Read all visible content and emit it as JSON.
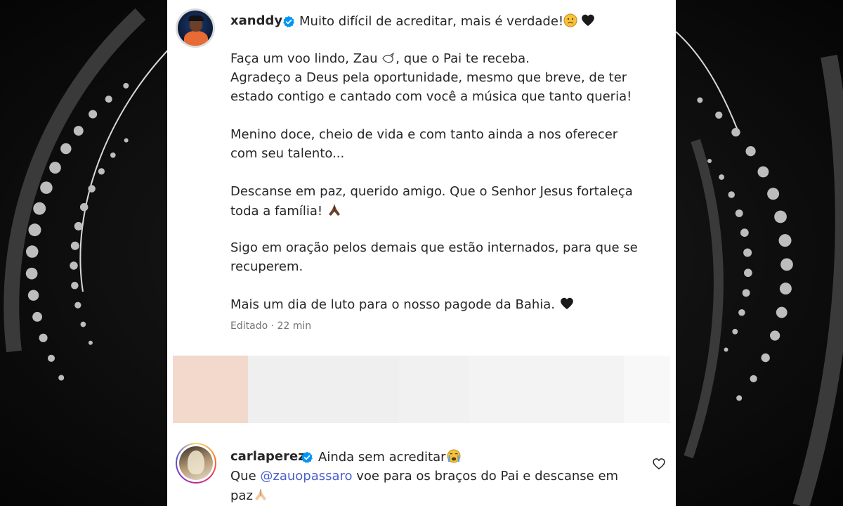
{
  "post": {
    "username": "xanddy",
    "caption_first": "Muito difícil de acreditar, mais é verdade!",
    "paragraphs": [
      "Faça um voo lindo, Zau",
      ", que o Pai te receba.",
      "Agradeço a Deus pela oportunidade, mesmo que breve, de ter",
      "estado contigo e cantado com você a música que tanto queria!",
      "Menino doce, cheio de vida e com tanto ainda a nos oferecer",
      "com seu talento...",
      "Descanse em paz, querido amigo. Que o Senhor Jesus fortaleça",
      "toda a família!",
      "Sigo em oração pelos demais que estão internados, para que se",
      "recuperem.",
      "Mais um dia de luto para o nosso pagode da Bahia."
    ],
    "meta": "Editado · 22 min"
  },
  "comment": {
    "username": "carlaperez",
    "text_first": "Ainda sem acreditar",
    "line2_prefix": "Que ",
    "mention": "@zauopassaro",
    "line2_suffix": " voe para os braços do Pai e descanse em",
    "line3": "paz"
  },
  "colors": {
    "verified": "#0095f6",
    "mention": "#4a5fd0",
    "background": "#0c0c0c",
    "card": "#ffffff"
  },
  "icons": {
    "verified": "verified-badge-icon",
    "like": "heart-icon",
    "dove": "dove-emoji",
    "sad": "sad-face-emoji",
    "black_heart": "black-heart-emoji",
    "pray": "praying-hands-emoji",
    "crying": "crying-face-emoji"
  }
}
